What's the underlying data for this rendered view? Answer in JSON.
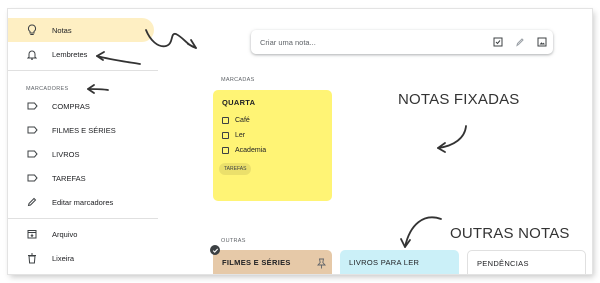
{
  "sidebar": {
    "items": [
      {
        "label": "Notas",
        "icon": "lightbulb-icon",
        "active": true
      },
      {
        "label": "Lembretes",
        "icon": "bell-icon",
        "active": false
      }
    ],
    "labels_section": "MARCADORES",
    "labels": [
      {
        "label": "COMPRAS",
        "icon": "label-icon"
      },
      {
        "label": "FILMES E SÉRIES",
        "icon": "label-icon"
      },
      {
        "label": "LIVROS",
        "icon": "label-icon"
      },
      {
        "label": "TAREFAS",
        "icon": "label-icon"
      }
    ],
    "edit_labels": "Editar marcadores",
    "bottom": [
      {
        "label": "Arquivo",
        "icon": "archive-icon"
      },
      {
        "label": "Lixeira",
        "icon": "trash-icon"
      }
    ]
  },
  "search": {
    "placeholder": "Criar uma nota...",
    "tools": [
      "checkbox-icon",
      "brush-icon",
      "image-icon"
    ]
  },
  "main": {
    "pinned_section": "MARCADAS",
    "pinned_note": {
      "title": "QUARTA",
      "items": [
        "Café",
        "Ler",
        "Academia"
      ],
      "chip": "TAREFAS",
      "color": "#fff475"
    },
    "others_section": "OUTRAS",
    "other_notes": [
      {
        "title": "FILMES E SÉRIES",
        "color": "#e6c9a8"
      },
      {
        "title": "LIVROS PARA LER",
        "color": "#cbf0f8"
      },
      {
        "title": "PENDÊNCIAS",
        "color": "#ffffff"
      }
    ]
  },
  "annotations": {
    "pinned": "NOTAS FIXADAS",
    "others": "OUTRAS NOTAS"
  }
}
